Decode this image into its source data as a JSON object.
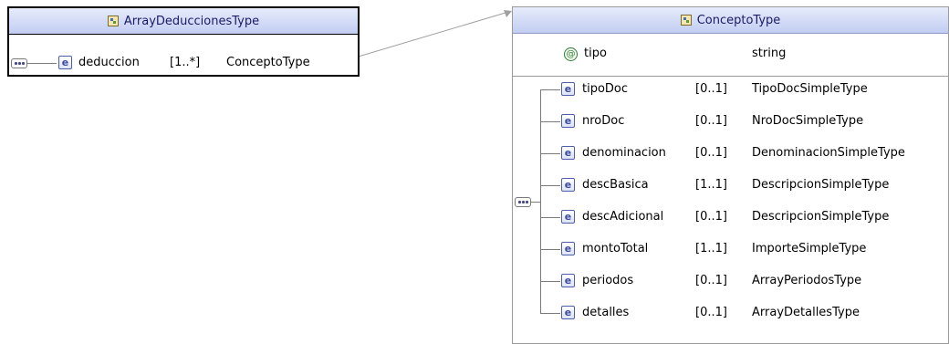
{
  "left": {
    "title": "ArrayDeduccionesType",
    "element": {
      "name": "deduccion",
      "card": "[1..*]",
      "type": "ConceptoType"
    }
  },
  "right": {
    "title": "ConceptoType",
    "attribute": {
      "icon": "@",
      "name": "tipo",
      "type": "string"
    },
    "elements": [
      {
        "name": "tipoDoc",
        "card": "[0..1]",
        "type": "TipoDocSimpleType"
      },
      {
        "name": "nroDoc",
        "card": "[0..1]",
        "type": "NroDocSimpleType"
      },
      {
        "name": "denominacion",
        "card": "[0..1]",
        "type": "DenominacionSimpleType"
      },
      {
        "name": "descBasica",
        "card": "[1..1]",
        "type": "DescripcionSimpleType"
      },
      {
        "name": "descAdicional",
        "card": "[0..1]",
        "type": "DescripcionSimpleType"
      },
      {
        "name": "montoTotal",
        "card": "[1..1]",
        "type": "ImporteSimpleType"
      },
      {
        "name": "periodos",
        "card": "[0..1]",
        "type": "ArrayPeriodosType"
      },
      {
        "name": "detalles",
        "card": "[0..1]",
        "type": "ArrayDetallesType"
      }
    ]
  },
  "icons": {
    "element": "e"
  },
  "colors": {
    "header_text": "#1a1a66",
    "element_icon": "#3a4aa0",
    "attribute_icon": "#2e7d32"
  }
}
